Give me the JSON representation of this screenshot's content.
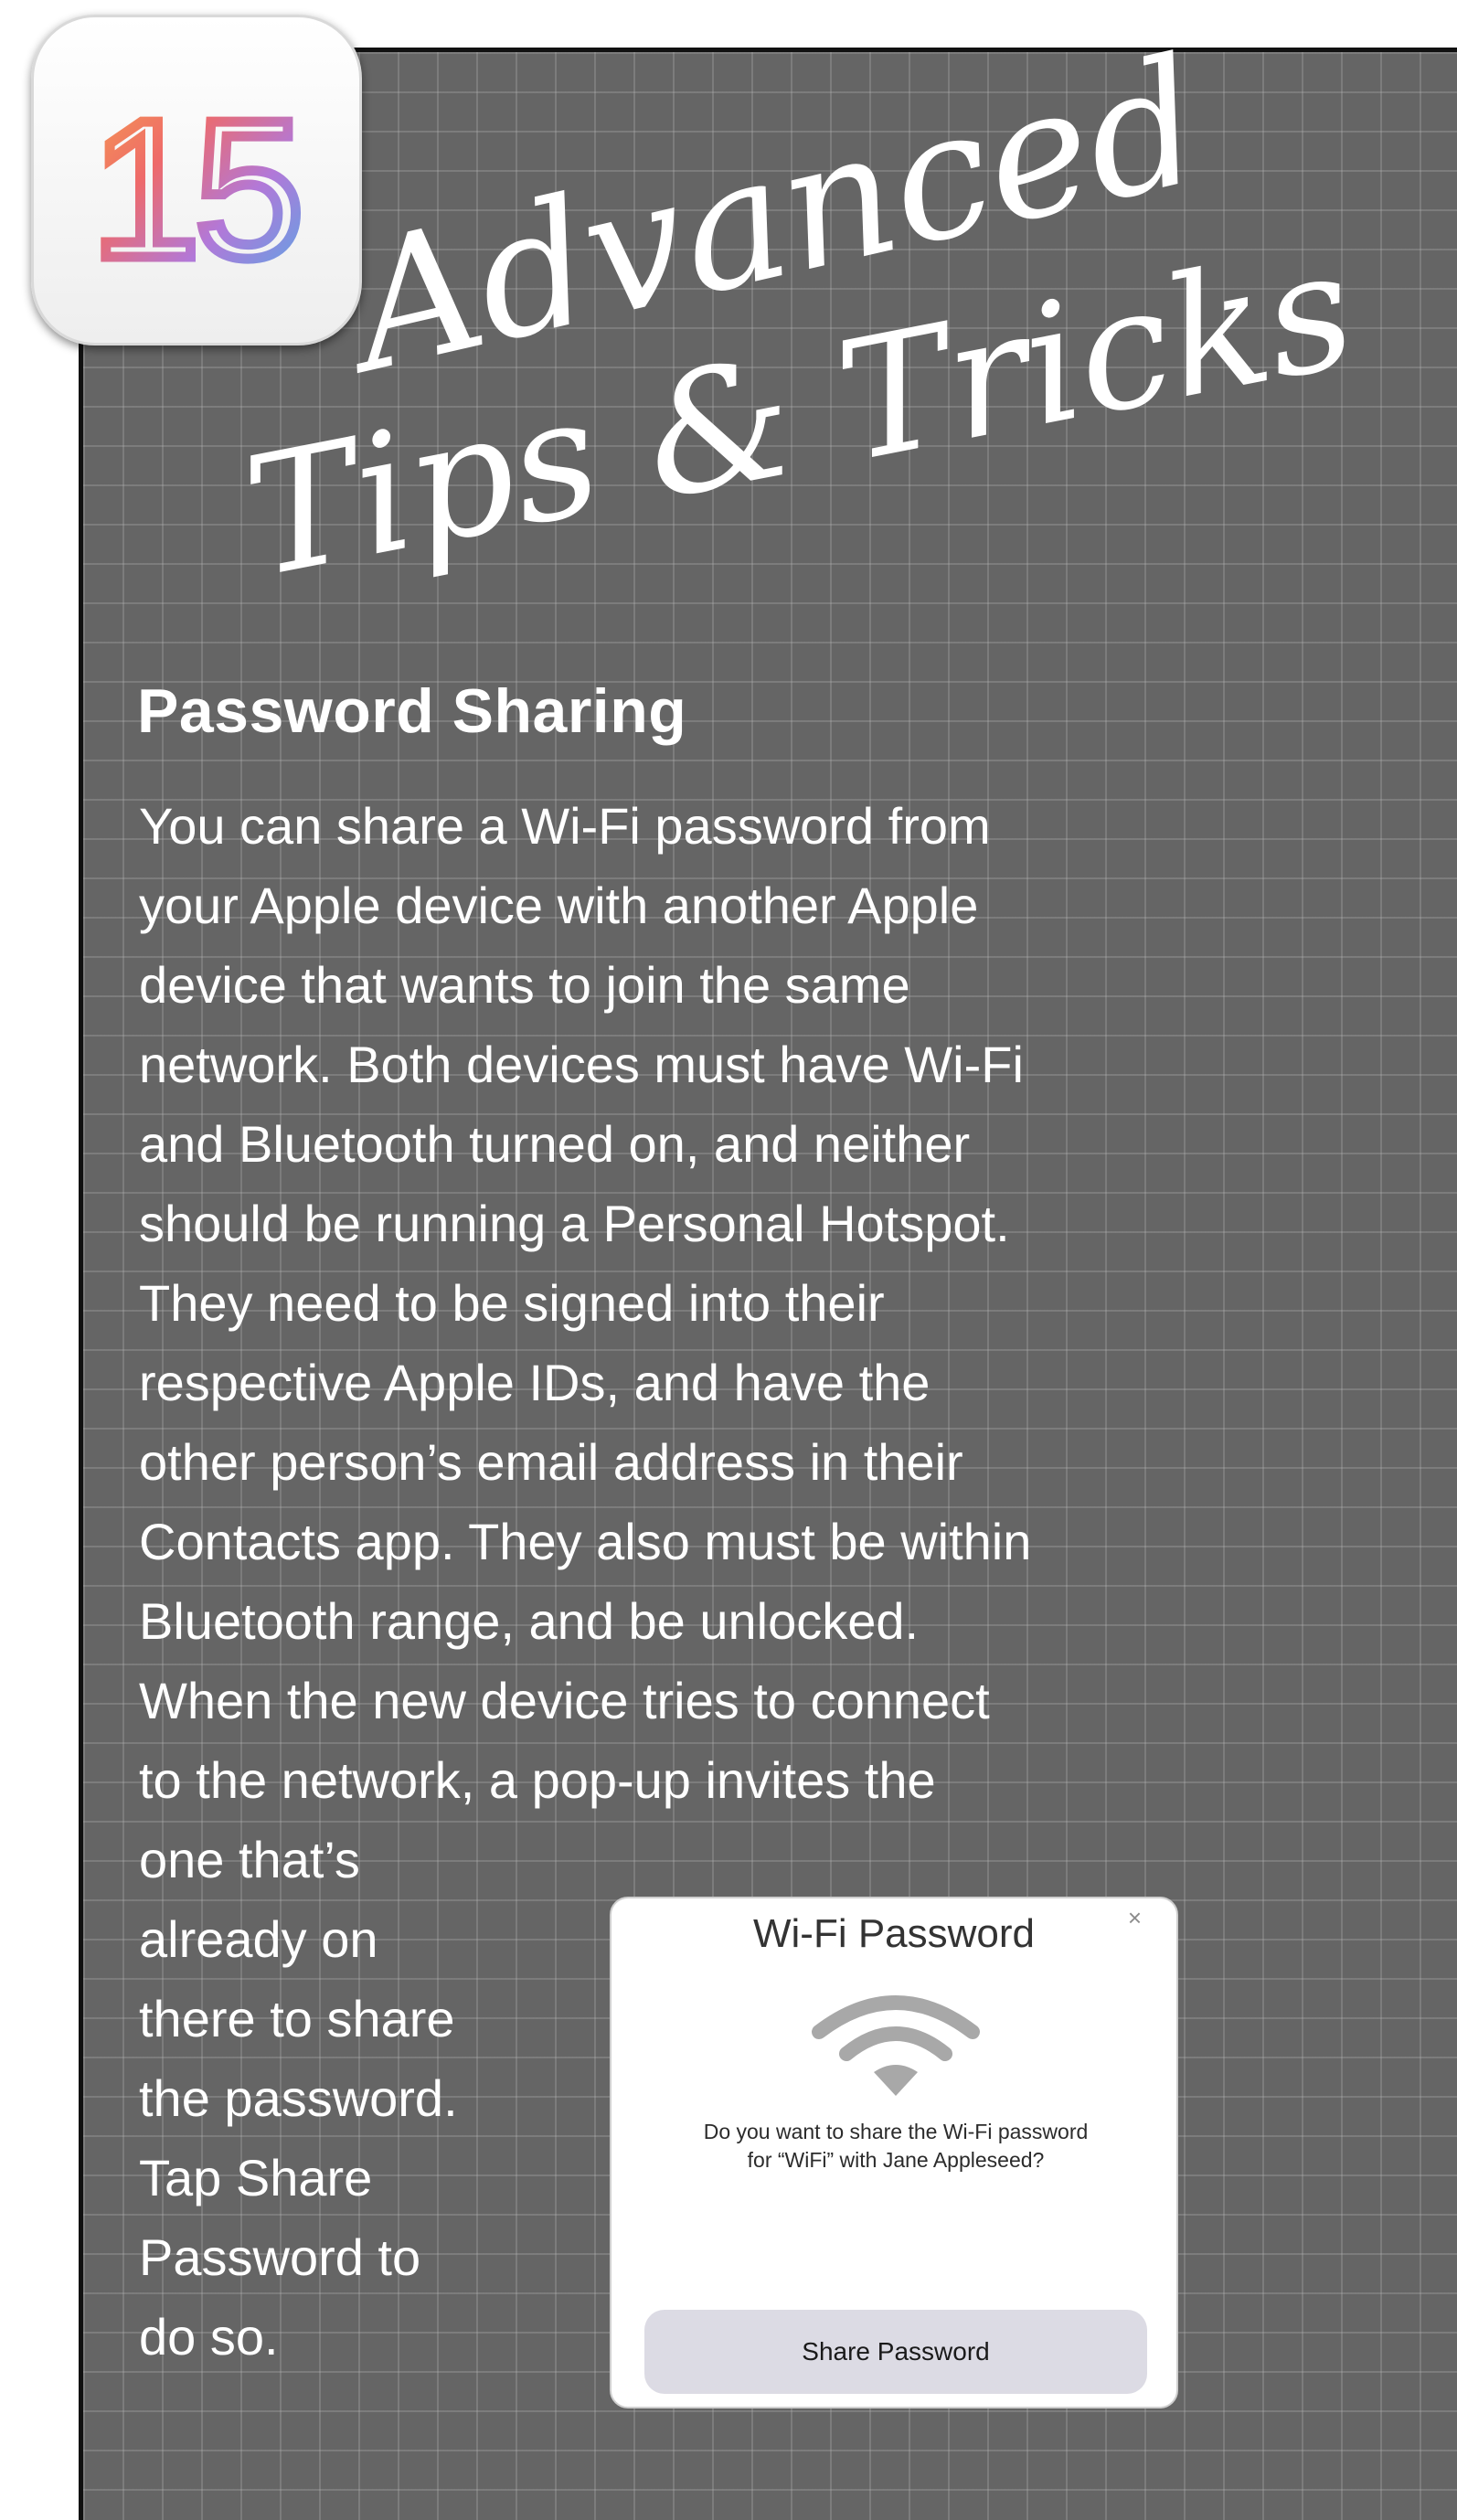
{
  "badge": {
    "number": "15"
  },
  "title": {
    "line1": "Advanced",
    "line2": "Tips & Tricks"
  },
  "section": {
    "heading": "Password Sharing",
    "lines": [
      "You can share a Wi-Fi password from",
      "your Apple device with another Apple",
      "device that wants to join the same",
      "network. Both devices must have Wi-Fi",
      "and Bluetooth turned on, and neither",
      "should be running a Personal Hotspot.",
      "They need to be signed into their",
      "respective Apple IDs, and have the",
      "other person’s email address in their",
      "Contacts app. They also must be within",
      "Bluetooth range, and be unlocked.",
      "When the new device tries to connect",
      "to the network, a pop-up invites the",
      "one that’s",
      "already on",
      "there to share",
      "the password.",
      "Tap Share",
      "Password to",
      "do so."
    ]
  },
  "dialog": {
    "title": "Wi-Fi Password",
    "close_glyph": "×",
    "message_line1": "Do you want to share the Wi-Fi password",
    "message_line2": "for “WiFi” with Jane Appleseed?",
    "button_label": "Share Password",
    "icon": "wifi-icon"
  },
  "colors": {
    "panel": "#656565",
    "grid": "#a9a9a9",
    "text": "#ffffff",
    "badge_gradient": [
      "#f6a04d",
      "#ee6a6a",
      "#b278d8",
      "#55a9e6"
    ]
  }
}
